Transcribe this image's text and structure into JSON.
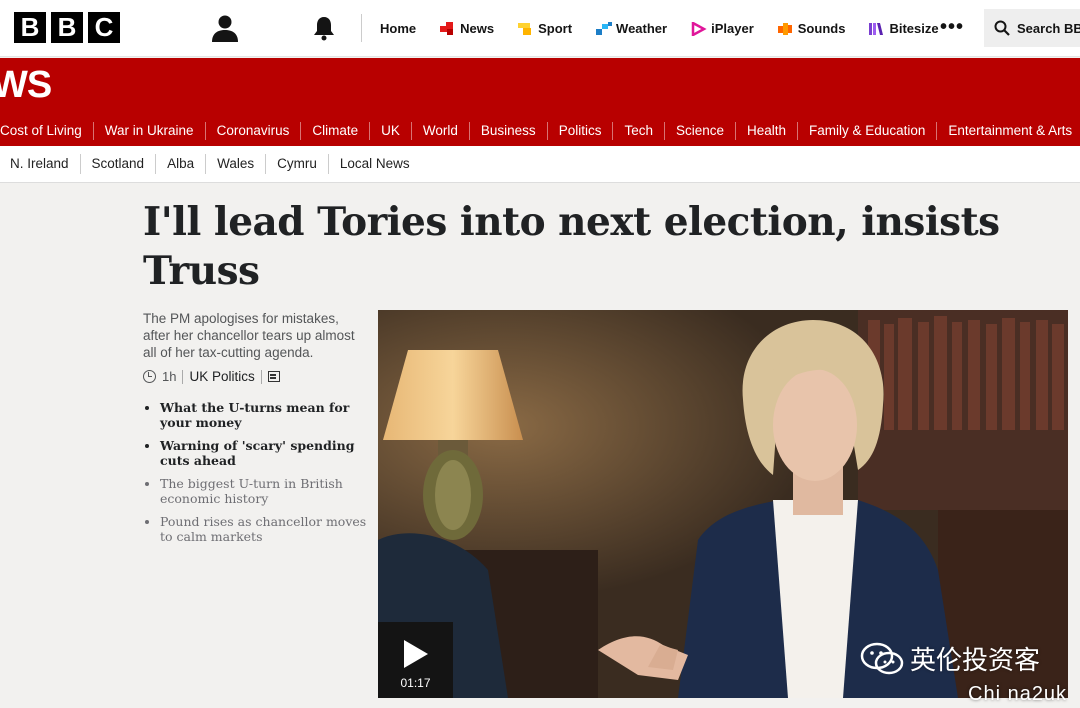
{
  "logo": {
    "letters": [
      "B",
      "B",
      "C"
    ]
  },
  "topnav": {
    "items": [
      {
        "label": "Home",
        "icon": "",
        "color": ""
      },
      {
        "label": "News",
        "icon": "news-icon",
        "color": "#e41a1a"
      },
      {
        "label": "Sport",
        "icon": "sport-icon",
        "color": "#ffd230"
      },
      {
        "label": "Weather",
        "icon": "weather-icon",
        "color": "#1c7ec7"
      },
      {
        "label": "iPlayer",
        "icon": "iplayer-icon",
        "color": "#e0169a"
      },
      {
        "label": "Sounds",
        "icon": "sounds-icon",
        "color": "#ff6600"
      },
      {
        "label": "Bitesize",
        "icon": "bitesize-icon",
        "color": "#7a3fd1"
      }
    ],
    "more": "•••",
    "search_label": "Search BBC"
  },
  "news_band": {
    "wordmark": "WS",
    "color": "#b80000"
  },
  "section_nav": [
    "Cost of Living",
    "War in Ukraine",
    "Coronavirus",
    "Climate",
    "UK",
    "World",
    "Business",
    "Politics",
    "Tech",
    "Science",
    "Health",
    "Family & Education",
    "Entertainment & Arts"
  ],
  "sub_nav": [
    "N. Ireland",
    "Scotland",
    "Alba",
    "Wales",
    "Cymru",
    "Local News"
  ],
  "article": {
    "headline": "I'll lead Tories into next election, insists Truss",
    "summary": "The PM apologises for mistakes, after her chancellor tears up almost all of her tax-cutting agenda.",
    "time": "1h",
    "topic": "UK Politics",
    "related": [
      {
        "text": "What the U-turns mean for your money",
        "style": "bold"
      },
      {
        "text": "Warning of 'scary' spending cuts ahead",
        "style": "bold"
      },
      {
        "text": "The biggest U-turn in British economic history",
        "style": "light"
      },
      {
        "text": "Pound rises as chancellor moves to calm markets",
        "style": "light"
      }
    ]
  },
  "video": {
    "duration": "01:17"
  },
  "watermark": {
    "text": "英伦投资客",
    "sub": "Chi na2uk"
  }
}
